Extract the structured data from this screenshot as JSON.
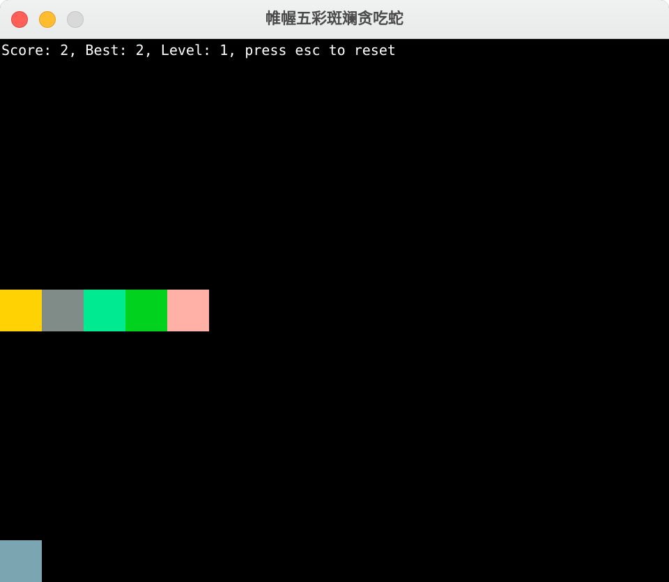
{
  "window": {
    "title": "帷幄五彩斑斓贪吃蛇"
  },
  "hud": {
    "text": "Score: 2, Best: 2, Level: 1, press esc to reset",
    "score": 2,
    "best": 2,
    "level": 1
  },
  "board": {
    "background": "#000000",
    "grid_columns": 16,
    "grid_rows": 13,
    "snake": [
      {
        "col": 0,
        "row": 6,
        "color": "#ffd203"
      },
      {
        "col": 1,
        "row": 6,
        "color": "#7f8c87"
      },
      {
        "col": 2,
        "row": 6,
        "color": "#00ea91"
      },
      {
        "col": 3,
        "row": 6,
        "color": "#00d21e"
      },
      {
        "col": 4,
        "row": 6,
        "color": "#ffb1a7"
      }
    ],
    "food": {
      "col": 0,
      "row": 12,
      "color": "#7aa5b1"
    }
  }
}
